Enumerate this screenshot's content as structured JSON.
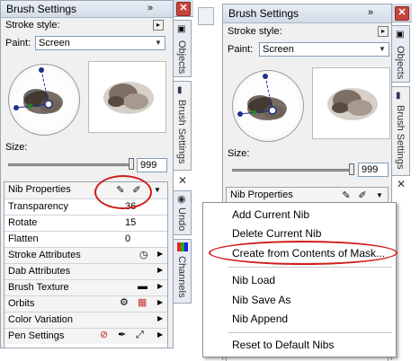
{
  "left": {
    "title": "Brush Settings",
    "collapse_label": "»",
    "stroke_style_label": "Stroke style:",
    "paint_label": "Paint:",
    "paint_value": "Screen",
    "size_label": "Size:",
    "size_value": "999",
    "nib_properties_label": "Nib Properties",
    "sub_rows": [
      {
        "label": "Transparency",
        "value": "36"
      },
      {
        "label": "Rotate",
        "value": "15"
      },
      {
        "label": "Flatten",
        "value": "0"
      }
    ],
    "sections": [
      "Stroke Attributes",
      "Dab Attributes",
      "Brush Texture",
      "Orbits",
      "Color Variation",
      "Pen Settings"
    ],
    "side_tabs": [
      "Objects",
      "Brush Settings",
      "Undo",
      "Channels"
    ]
  },
  "right": {
    "title": "Brush Settings",
    "collapse_label": "»",
    "stroke_style_label": "Stroke style:",
    "paint_label": "Paint:",
    "paint_value": "Screen",
    "size_label": "Size:",
    "size_value": "999",
    "nib_properties_label": "Nib Properties",
    "side_tabs": [
      "Objects",
      "Brush Settings"
    ]
  },
  "context_menu": {
    "items": [
      "Add Current Nib",
      "Delete Current Nib",
      "Create from Contents of Mask...",
      "Nib Load",
      "Nib Save As",
      "Nib Append",
      "Reset to Default Nibs"
    ]
  },
  "colors": {
    "highlight_ring": "#d01d1d",
    "panel_bg": "#f0f0f0",
    "title_bg": "#d3dbe7"
  }
}
